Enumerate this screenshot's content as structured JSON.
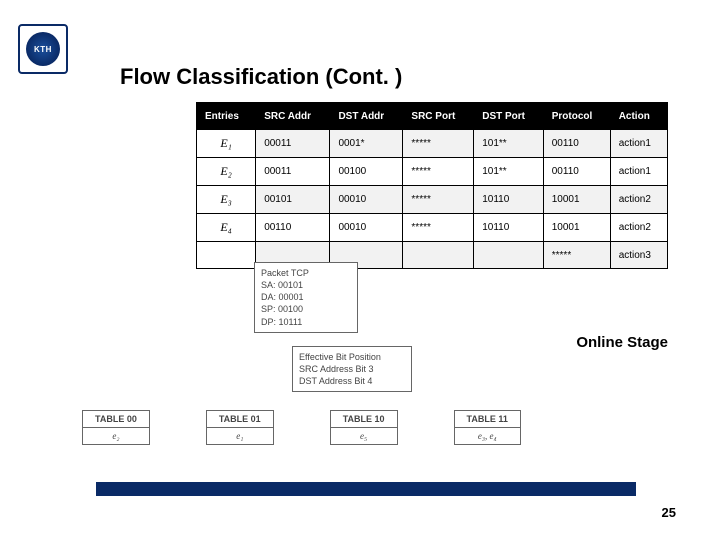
{
  "logo_text": "KTH",
  "title": "Flow Classification (Cont. )",
  "headers": [
    "Entries",
    "SRC Addr",
    "DST Addr",
    "SRC Port",
    "DST Port",
    "Protocol",
    "Action"
  ],
  "rows": [
    {
      "entry": "E₁",
      "src_addr": "00011",
      "dst_addr": "0001*",
      "src_port": "*****",
      "dst_port": "101**",
      "protocol": "00110",
      "action": "action1"
    },
    {
      "entry": "E₂",
      "src_addr": "00011",
      "dst_addr": "00100",
      "src_port": "*****",
      "dst_port": "101**",
      "protocol": "00110",
      "action": "action1"
    },
    {
      "entry": "E₃",
      "src_addr": "00101",
      "dst_addr": "00010",
      "src_port": "*****",
      "dst_port": "10110",
      "protocol": "10001",
      "action": "action2"
    },
    {
      "entry": "E₄",
      "src_addr": "00110",
      "dst_addr": "00010",
      "src_port": "*****",
      "dst_port": "10110",
      "protocol": "10001",
      "action": "action2"
    },
    {
      "entry": "",
      "src_addr": "",
      "dst_addr": "",
      "src_port": "",
      "dst_port": "",
      "protocol": "*****",
      "action": "action3"
    }
  ],
  "packet": {
    "title": "Packet TCP",
    "lines": [
      "SA: 00101",
      "DA: 00001",
      "SP: 00100",
      "DP: 10111"
    ]
  },
  "eff_box": {
    "title": "Effective Bit Position",
    "lines": [
      "SRC Address Bit 3",
      "DST Address Bit 4"
    ]
  },
  "online_stage": "Online Stage",
  "mini_tables": [
    {
      "head": "TABLE 00",
      "body": "e₂"
    },
    {
      "head": "TABLE 01",
      "body": "e₁"
    },
    {
      "head": "TABLE 10",
      "body": "e₅"
    },
    {
      "head": "TABLE 11",
      "body": "e₃, e₄"
    }
  ],
  "page_number": "25"
}
